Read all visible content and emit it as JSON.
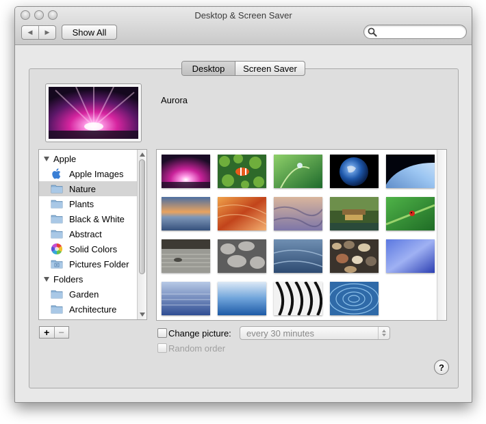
{
  "window": {
    "title": "Desktop & Screen Saver"
  },
  "toolbar": {
    "back_icon": "triangle-left",
    "forward_icon": "triangle-right",
    "show_all_label": "Show All",
    "search_placeholder": "",
    "search_icon": "magnifier"
  },
  "tabs": [
    {
      "label": "Desktop",
      "selected": true
    },
    {
      "label": "Screen Saver",
      "selected": false
    }
  ],
  "current_picture": {
    "name": "Aurora"
  },
  "sources": [
    {
      "kind": "group",
      "label": "Apple",
      "expanded": true
    },
    {
      "kind": "item",
      "label": "Apple Images",
      "icon": "apple-logo"
    },
    {
      "kind": "item",
      "label": "Nature",
      "icon": "folder",
      "selected": true
    },
    {
      "kind": "item",
      "label": "Plants",
      "icon": "folder"
    },
    {
      "kind": "item",
      "label": "Black & White",
      "icon": "folder"
    },
    {
      "kind": "item",
      "label": "Abstract",
      "icon": "folder"
    },
    {
      "kind": "item",
      "label": "Solid Colors",
      "icon": "color-wheel"
    },
    {
      "kind": "item",
      "label": "Pictures Folder",
      "icon": "pictures-folder"
    },
    {
      "kind": "group",
      "label": "Folders",
      "expanded": true
    },
    {
      "kind": "item",
      "label": "Garden",
      "icon": "folder"
    },
    {
      "kind": "item",
      "label": "Architecture",
      "icon": "folder"
    }
  ],
  "source_buttons": {
    "add": "+",
    "remove": "−"
  },
  "thumbnails": [
    "aurora",
    "clownfish",
    "dewdrop-stem",
    "earth",
    "earth-horizon",
    "sunset-water",
    "sandstone",
    "sand-dunes",
    "pagoda",
    "ladybug",
    "zen-garden",
    "grey-pebbles",
    "blue-sand",
    "colored-pebbles",
    "blue-abstract",
    "blue-ripples",
    "blue-water",
    "zebra",
    "water-rings"
  ],
  "options": {
    "change_picture_label": "Change picture:",
    "change_picture_checked": false,
    "interval": "every 30 minutes",
    "random_order_label": "Random order",
    "random_order_checked": false,
    "random_order_enabled": false
  },
  "help_label": "?",
  "colors": {
    "selection": "#d4d4d4",
    "window": "#e8e8e8",
    "panel": "#dedede"
  }
}
